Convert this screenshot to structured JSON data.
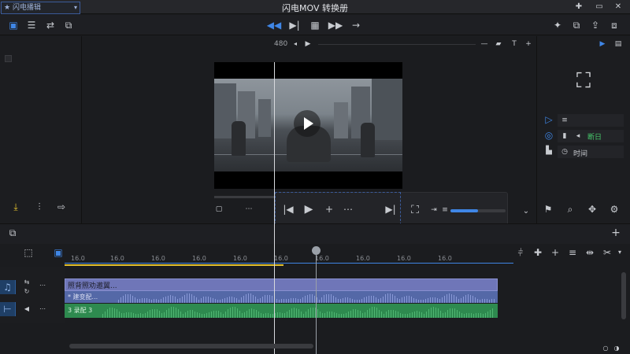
{
  "window": {
    "title": "闪电MOV 转换册"
  },
  "left_panel": {
    "dropdown_label": "闪电播辑"
  },
  "viewer": {
    "resolution": "480"
  },
  "right_panel": {
    "row2_label": "断日",
    "row3_label": "时间"
  },
  "timeline": {
    "ruler_ticks": [
      "16.0",
      "16.0",
      "16.0",
      "16.0",
      "16.0",
      "16.0",
      "16.0",
      "16.0",
      "16.0",
      "16.0"
    ],
    "video_clip_label": "照背照劝邀翼...",
    "audio_clip1_label": "* 建变配...",
    "audio_clip2_label": "3 录配 3"
  },
  "colors": {
    "accent": "#3f86e6",
    "video_clip": "#6f76b8",
    "audio_clip": "#2e8a4f",
    "playline": "#e2c02f"
  }
}
